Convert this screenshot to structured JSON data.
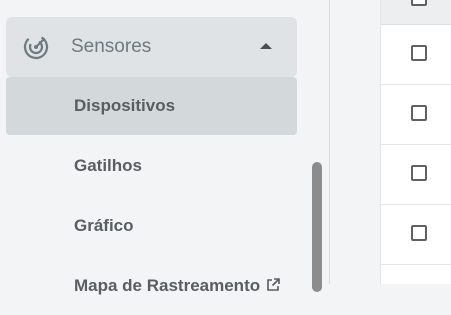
{
  "sidebar": {
    "group": {
      "label": "Sensores",
      "icon": "radar-icon",
      "expanded": true
    },
    "items": [
      {
        "label": "Dispositivos",
        "active": true
      },
      {
        "label": "Gatilhos",
        "active": false
      },
      {
        "label": "Gráfico",
        "active": false
      },
      {
        "label": "Mapa de Rastreamento",
        "active": false,
        "icon": "external-link-icon"
      }
    ]
  },
  "table": {
    "row_count": 4
  },
  "colors": {
    "sidebar_bg": "#f3f4f5",
    "group_bg": "#dfe3e5",
    "active_item_bg": "#d3d8db",
    "icon_color": "#6e7a80"
  }
}
